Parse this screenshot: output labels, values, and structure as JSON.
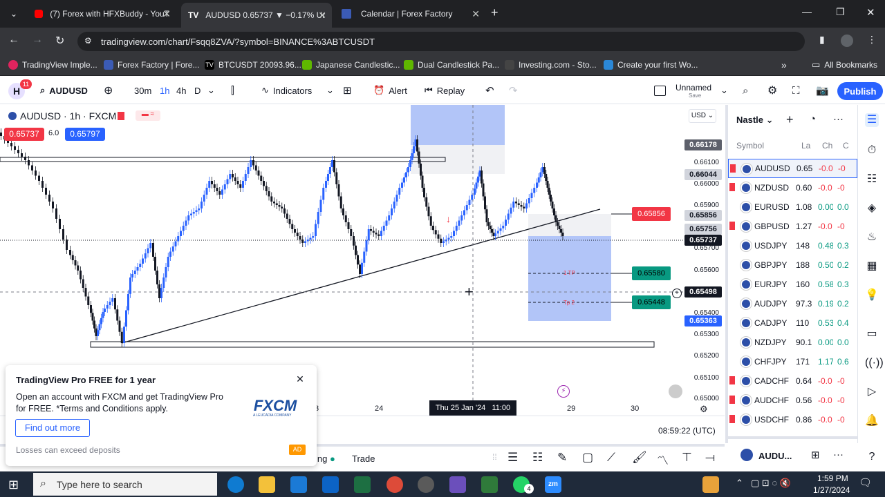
{
  "browser": {
    "tabs": [
      {
        "label": "(7) Forex with HFXBuddy - YouT",
        "active": false
      },
      {
        "label": "AUDUSD 0.65737 ▼ −0.17% Ur",
        "active": true
      },
      {
        "label": "Calendar | Forex Factory",
        "active": false
      }
    ],
    "url": "tradingview.com/chart/Fsqq8ZVA/?symbol=BINANCE%3ABTCUSDT",
    "bookmarks": [
      "TradingView Imple...",
      "Forex Factory | Fore...",
      "BTCUSDT 20093.96...",
      "Japanese Candlestic...",
      "Dual Candlestick Pa...",
      "Investing.com - Sto...",
      "Create your first Wo..."
    ],
    "all_bookmarks": "All Bookmarks"
  },
  "toolbar": {
    "avatar_letter": "H",
    "avatar_badge": "11",
    "symbol": "AUDUSD",
    "intervals": [
      "30m",
      "1h",
      "4h",
      "D"
    ],
    "indicators_label": "Indicators",
    "alert_label": "Alert",
    "replay_label": "Replay",
    "layout_name": "Unnamed",
    "layout_save": "Save",
    "publish_label": "Publish"
  },
  "chart": {
    "title": "AUDUSD · 1h · FXCM",
    "bid": "0.65737",
    "spread": "6.0",
    "ask": "0.65797",
    "currency": "USD",
    "price_ticks": [
      "0.66100",
      "0.66000",
      "0.65900",
      "0.65700",
      "0.65600",
      "0.65400",
      "0.65300",
      "0.65200",
      "0.65100",
      "0.65000"
    ],
    "price_boxes": [
      {
        "value": "0.66178",
        "color": "#5d606b"
      },
      {
        "value": "0.66044",
        "color": "#d1d4dc"
      },
      {
        "value": "0.65856",
        "color": "#d1d4dc"
      },
      {
        "value": "0.65756",
        "color": "#d1d4dc"
      },
      {
        "value": "0.65737",
        "color": "#131722"
      },
      {
        "value": "0.65498",
        "color": "#131722"
      },
      {
        "value": "0.65363",
        "color": "#2962ff"
      }
    ],
    "order_labels": [
      {
        "value": "0.65856",
        "color": "#f23645"
      },
      {
        "value": "0.65580",
        "color": "#089981"
      },
      {
        "value": "0.65448",
        "color": "#089981"
      }
    ],
    "tp1_label": "1 TP",
    "tp2_label": "Tp 2",
    "time_labels": [
      "3",
      "24",
      "29",
      "30"
    ],
    "crosshair_time": "Thu 25 Jan '24   11:00",
    "clock": "08:59:22 (UTC)"
  },
  "watchlist": {
    "name": "Nastle",
    "headers": [
      "Symbol",
      "La",
      "Ch",
      "C"
    ],
    "rows": [
      {
        "sym": "AUDUSD",
        "last": "0.65",
        "chg": "-0.0",
        "pct": "-0",
        "dir": "dn"
      },
      {
        "sym": "NZDUSD",
        "last": "0.60",
        "chg": "-0.0",
        "pct": "-0",
        "dir": "dn"
      },
      {
        "sym": "EURUSD",
        "last": "1.08",
        "chg": "0.00",
        "pct": "0.0",
        "dir": "up"
      },
      {
        "sym": "GBPUSD",
        "last": "1.27",
        "chg": "-0.0",
        "pct": "-0",
        "dir": "dn"
      },
      {
        "sym": "USDJPY",
        "last": "148",
        "chg": "0.48",
        "pct": "0.3",
        "dir": "up"
      },
      {
        "sym": "GBPJPY",
        "last": "188",
        "chg": "0.50",
        "pct": "0.2",
        "dir": "up"
      },
      {
        "sym": "EURJPY",
        "last": "160",
        "chg": "0.58",
        "pct": "0.3",
        "dir": "up"
      },
      {
        "sym": "AUDJPY",
        "last": "97.3",
        "chg": "0.19",
        "pct": "0.2",
        "dir": "up"
      },
      {
        "sym": "CADJPY",
        "last": "110",
        "chg": "0.53",
        "pct": "0.4",
        "dir": "up"
      },
      {
        "sym": "NZDJPY",
        "last": "90.1",
        "chg": "0.00",
        "pct": "0.0",
        "dir": "up"
      },
      {
        "sym": "CHFJPY",
        "last": "171",
        "chg": "1.17",
        "pct": "0.6",
        "dir": "up"
      },
      {
        "sym": "CADCHF",
        "last": "0.64",
        "chg": "-0.0",
        "pct": "-0",
        "dir": "dn"
      },
      {
        "sym": "AUDCHF",
        "last": "0.56",
        "chg": "-0.0",
        "pct": "-0",
        "dir": "dn"
      },
      {
        "sym": "USDCHF",
        "last": "0.86",
        "chg": "-0.0",
        "pct": "-0",
        "dir": "dn"
      }
    ],
    "footer_symbol": "AUDU..."
  },
  "bottom": {
    "trading_tab": "ing",
    "trade_tab": "Trade"
  },
  "ad": {
    "title": "TradingView Pro FREE for 1 year",
    "body": "Open an account with FXCM and get TradingView Pro for FREE. *Terms and Conditions apply.",
    "cta": "Find out more",
    "disclaimer": "Losses can exceed deposits",
    "badge": "AD",
    "brand": "FXCM",
    "brand_sub": "A LEUCADIA COMPANY"
  },
  "taskbar": {
    "search_placeholder": "Type here to search",
    "time": "1:59 PM",
    "date": "1/27/2024",
    "whatsapp_badge": "4"
  }
}
